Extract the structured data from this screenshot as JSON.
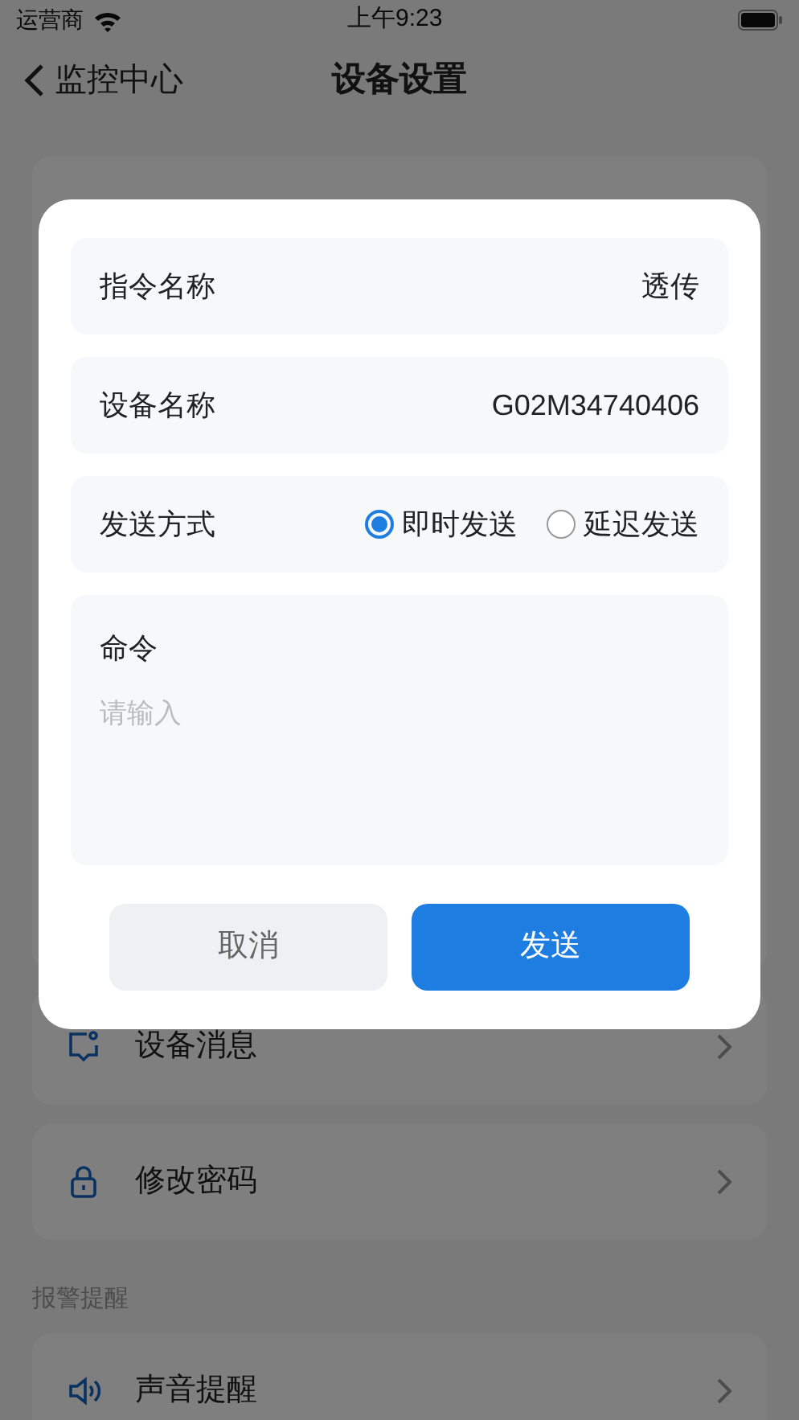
{
  "status_bar": {
    "carrier": "运营商",
    "time": "上午9:23"
  },
  "nav": {
    "back_label": "监控中心",
    "title": "设备设置"
  },
  "settings": [
    {
      "label": "设备消息"
    },
    {
      "label": "修改密码"
    }
  ],
  "alarm_section": {
    "heading": "报警提醒",
    "items": [
      {
        "label": "声音提醒"
      }
    ]
  },
  "dialog": {
    "command_name": {
      "label": "指令名称",
      "value": "透传"
    },
    "device_name": {
      "label": "设备名称",
      "value": "G02M34740406"
    },
    "send_mode": {
      "label": "发送方式",
      "options": [
        {
          "label": "即时发送",
          "selected": true
        },
        {
          "label": "延迟发送",
          "selected": false
        }
      ]
    },
    "command": {
      "label": "命令",
      "placeholder": "请输入"
    },
    "buttons": {
      "cancel": "取消",
      "send": "发送"
    }
  }
}
